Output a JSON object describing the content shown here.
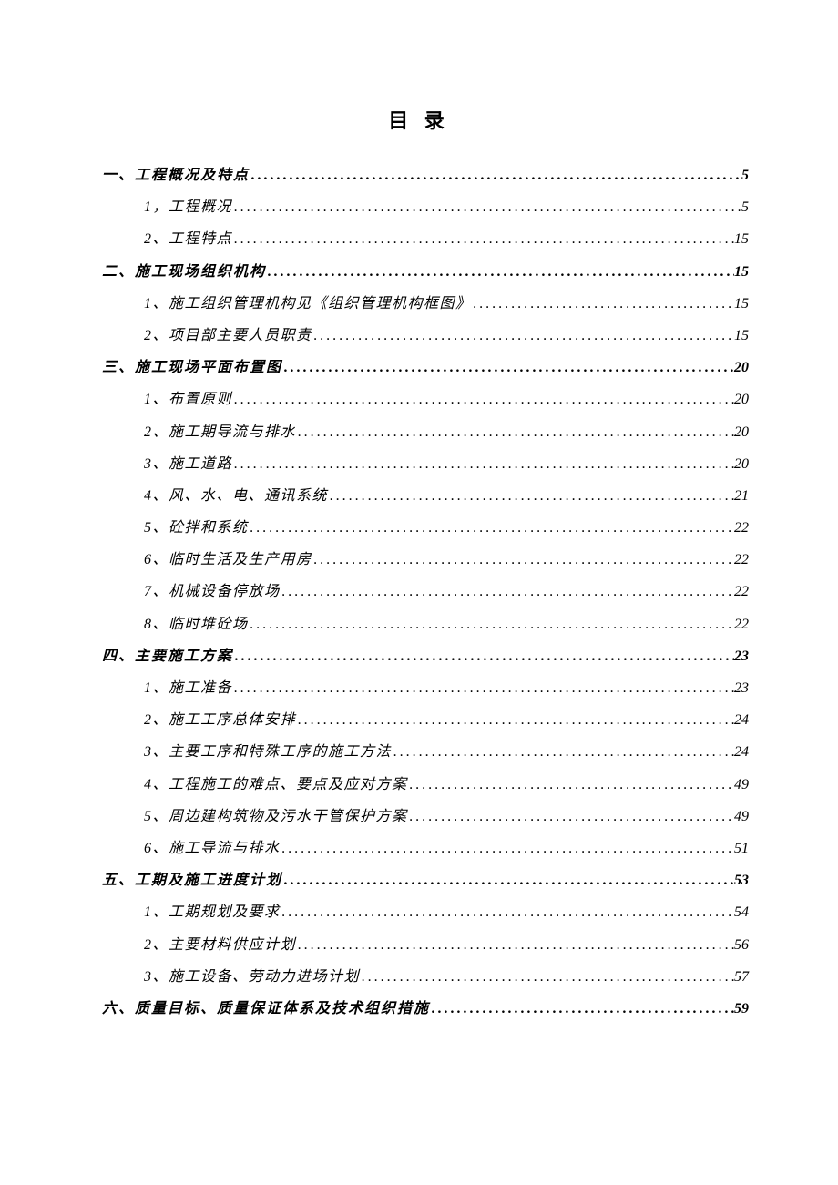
{
  "title": "目 录",
  "toc": [
    {
      "level": 1,
      "label": "一、工程概况及特点",
      "page": "5"
    },
    {
      "level": 2,
      "label": "1，工程概况",
      "page": "5"
    },
    {
      "level": 2,
      "label": "2、工程特点",
      "page": "15"
    },
    {
      "level": 1,
      "label": "二、施工现场组织机构",
      "page": "15"
    },
    {
      "level": 2,
      "label": "1、施工组织管理机构见《组织管理机构框图》",
      "page": "15"
    },
    {
      "level": 2,
      "label": "2、项目部主要人员职责",
      "page": "15"
    },
    {
      "level": 1,
      "label": "三、施工现场平面布置图",
      "page": "20"
    },
    {
      "level": 2,
      "label": "1、布置原则",
      "page": "20"
    },
    {
      "level": 2,
      "label": "2、施工期导流与排水",
      "page": "20"
    },
    {
      "level": 2,
      "label": "3、施工道路",
      "page": "20"
    },
    {
      "level": 2,
      "label": "4、风、水、电、通讯系统",
      "page": "21"
    },
    {
      "level": 2,
      "label": "5、砼拌和系统",
      "page": "22"
    },
    {
      "level": 2,
      "label": "6、临时生活及生产用房",
      "page": "22"
    },
    {
      "level": 2,
      "label": "7、机械设备停放场",
      "page": "22"
    },
    {
      "level": 2,
      "label": "8、临时堆砼场",
      "page": "22"
    },
    {
      "level": 1,
      "label": "四、主要施工方案",
      "page": "23"
    },
    {
      "level": 2,
      "label": "1、施工准备",
      "page": "23"
    },
    {
      "level": 2,
      "label": "2、施工工序总体安排",
      "page": "24"
    },
    {
      "level": 2,
      "label": "3、主要工序和特殊工序的施工方法",
      "page": "24"
    },
    {
      "level": 2,
      "label": "4、工程施工的难点、要点及应对方案",
      "page": "49"
    },
    {
      "level": 2,
      "label": "5、周边建构筑物及污水干管保护方案",
      "page": "49"
    },
    {
      "level": 2,
      "label": "6、施工导流与排水",
      "page": "51"
    },
    {
      "level": 1,
      "label": "五、工期及施工进度计划",
      "page": "53"
    },
    {
      "level": 2,
      "label": "1、工期规划及要求",
      "page": "54"
    },
    {
      "level": 2,
      "label": "2、主要材料供应计划",
      "page": "56"
    },
    {
      "level": 2,
      "label": "3、施工设备、劳动力进场计划",
      "page": "57"
    },
    {
      "level": 1,
      "label": "六、质量目标、质量保证体系及技术组织措施",
      "page": "59"
    }
  ]
}
